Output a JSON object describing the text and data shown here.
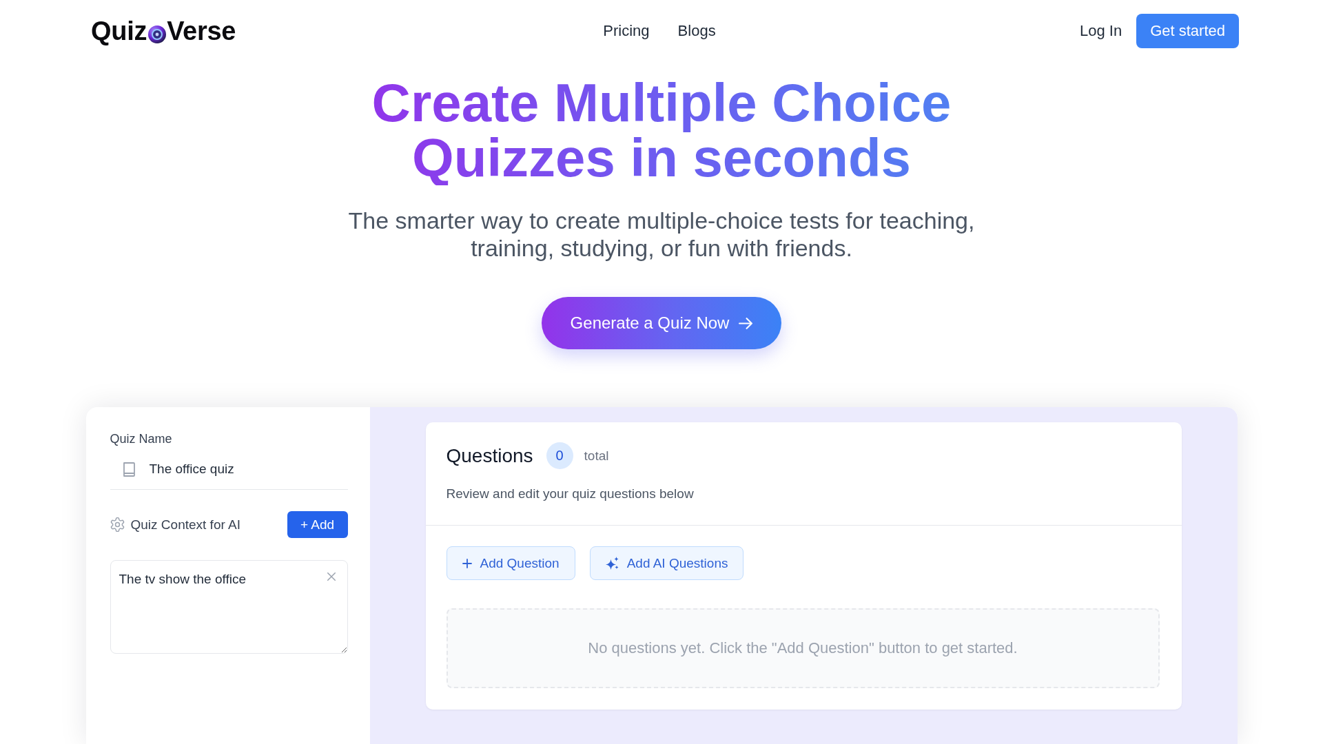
{
  "header": {
    "logo": {
      "left": "Quiz",
      "right": "Verse"
    },
    "nav": [
      "Pricing",
      "Blogs"
    ],
    "login": "Log In",
    "cta": "Get started"
  },
  "hero": {
    "title": "Create Multiple Choice Quizzes in seconds",
    "subtitle": "The smarter way to create multiple-choice tests for teaching, training, studying, or fun with friends.",
    "button": "Generate a Quiz Now"
  },
  "editor": {
    "quiz_name": {
      "label": "Quiz Name",
      "value": "The office quiz"
    },
    "context": {
      "label": "Quiz Context for AI",
      "add_button": "+ Add",
      "value": "The tv show the office"
    }
  },
  "questions": {
    "title": "Questions",
    "count": "0",
    "count_label": "total",
    "description": "Review and edit your quiz questions below",
    "actions": [
      {
        "kind": "manual",
        "label": "Add Question"
      },
      {
        "kind": "ai",
        "label": "Add AI Questions"
      }
    ],
    "empty_message": "No questions yet. Click the \"Add Question\" button to get started."
  }
}
